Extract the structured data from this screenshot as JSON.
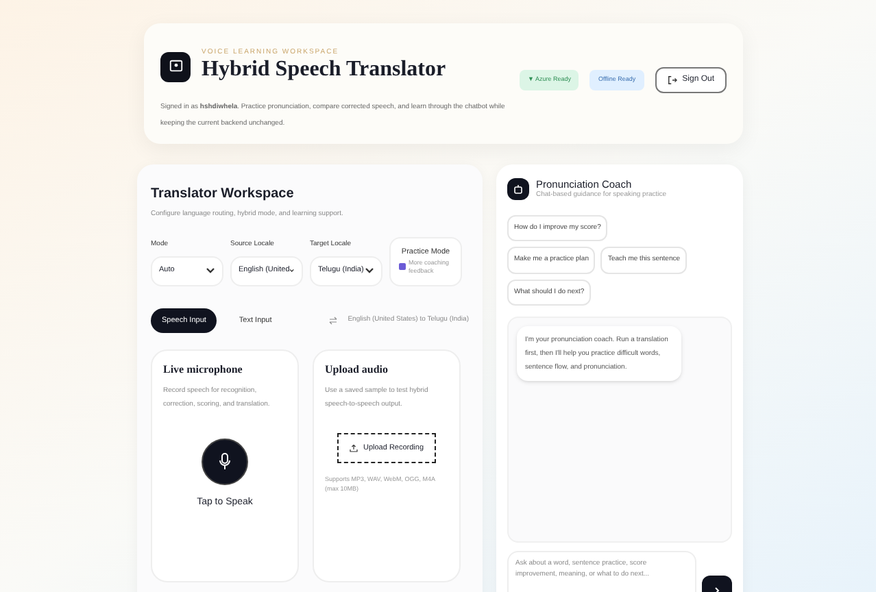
{
  "header": {
    "eyebrow": "VOICE LEARNING WORKSPACE",
    "title": "Hybrid Speech Translator",
    "intro": "Signed in as **hshdiwhela**. Practice pronunciation, compare corrected speech, and learn through the chatbot while keeping the current backend unchanged.",
    "badges": [
      {
        "label": "Azure Ready",
        "kind": "azure",
        "dot": "▼"
      },
      {
        "label": "Offline Ready",
        "kind": "offline"
      }
    ],
    "sign_out": "Sign Out"
  },
  "workspace": {
    "title": "Translator Workspace",
    "subtitle": "Configure language routing, hybrid mode, and learning support.",
    "selects": [
      {
        "label": "Mode",
        "value": "Auto"
      },
      {
        "label": "Source Locale",
        "value": "English (United"
      },
      {
        "label": "Target Locale",
        "value": "Telugu (India)"
      }
    ],
    "practice": {
      "title": "Practice Mode",
      "hint": "More coaching feedback",
      "checked": true
    },
    "tabs": [
      {
        "label": "Speech Input",
        "selected": true
      },
      {
        "label": "Text Input",
        "selected": false
      }
    ],
    "route": "English (United States) to Telugu (India)",
    "live": {
      "title": "Live microphone",
      "text": "Record speech for recognition, correction, scoring, and translation.",
      "action": "Tap to Speak"
    },
    "upload": {
      "title": "Upload audio",
      "text": "Use a saved sample to test hybrid speech-to-speech output.",
      "button": "Upload Recording",
      "note": "Supports MP3, WAV, WebM, OGG, M4A (max 10MB)"
    }
  },
  "coach": {
    "title": "Pronunciation Coach",
    "subtitle": "Chat-based guidance for speaking practice",
    "suggestions": [
      "How do I improve my score?",
      "Make me a practice plan",
      "Teach me this sentence",
      "What should I do next?"
    ],
    "message": "I'm your pronunciation coach. Run a translation first, then I'll help you practice difficult words, sentence flow, and pronunciation.",
    "input": {
      "placeholder": "Ask about a word, sentence practice, score improvement, meaning, or what to do next..."
    }
  }
}
